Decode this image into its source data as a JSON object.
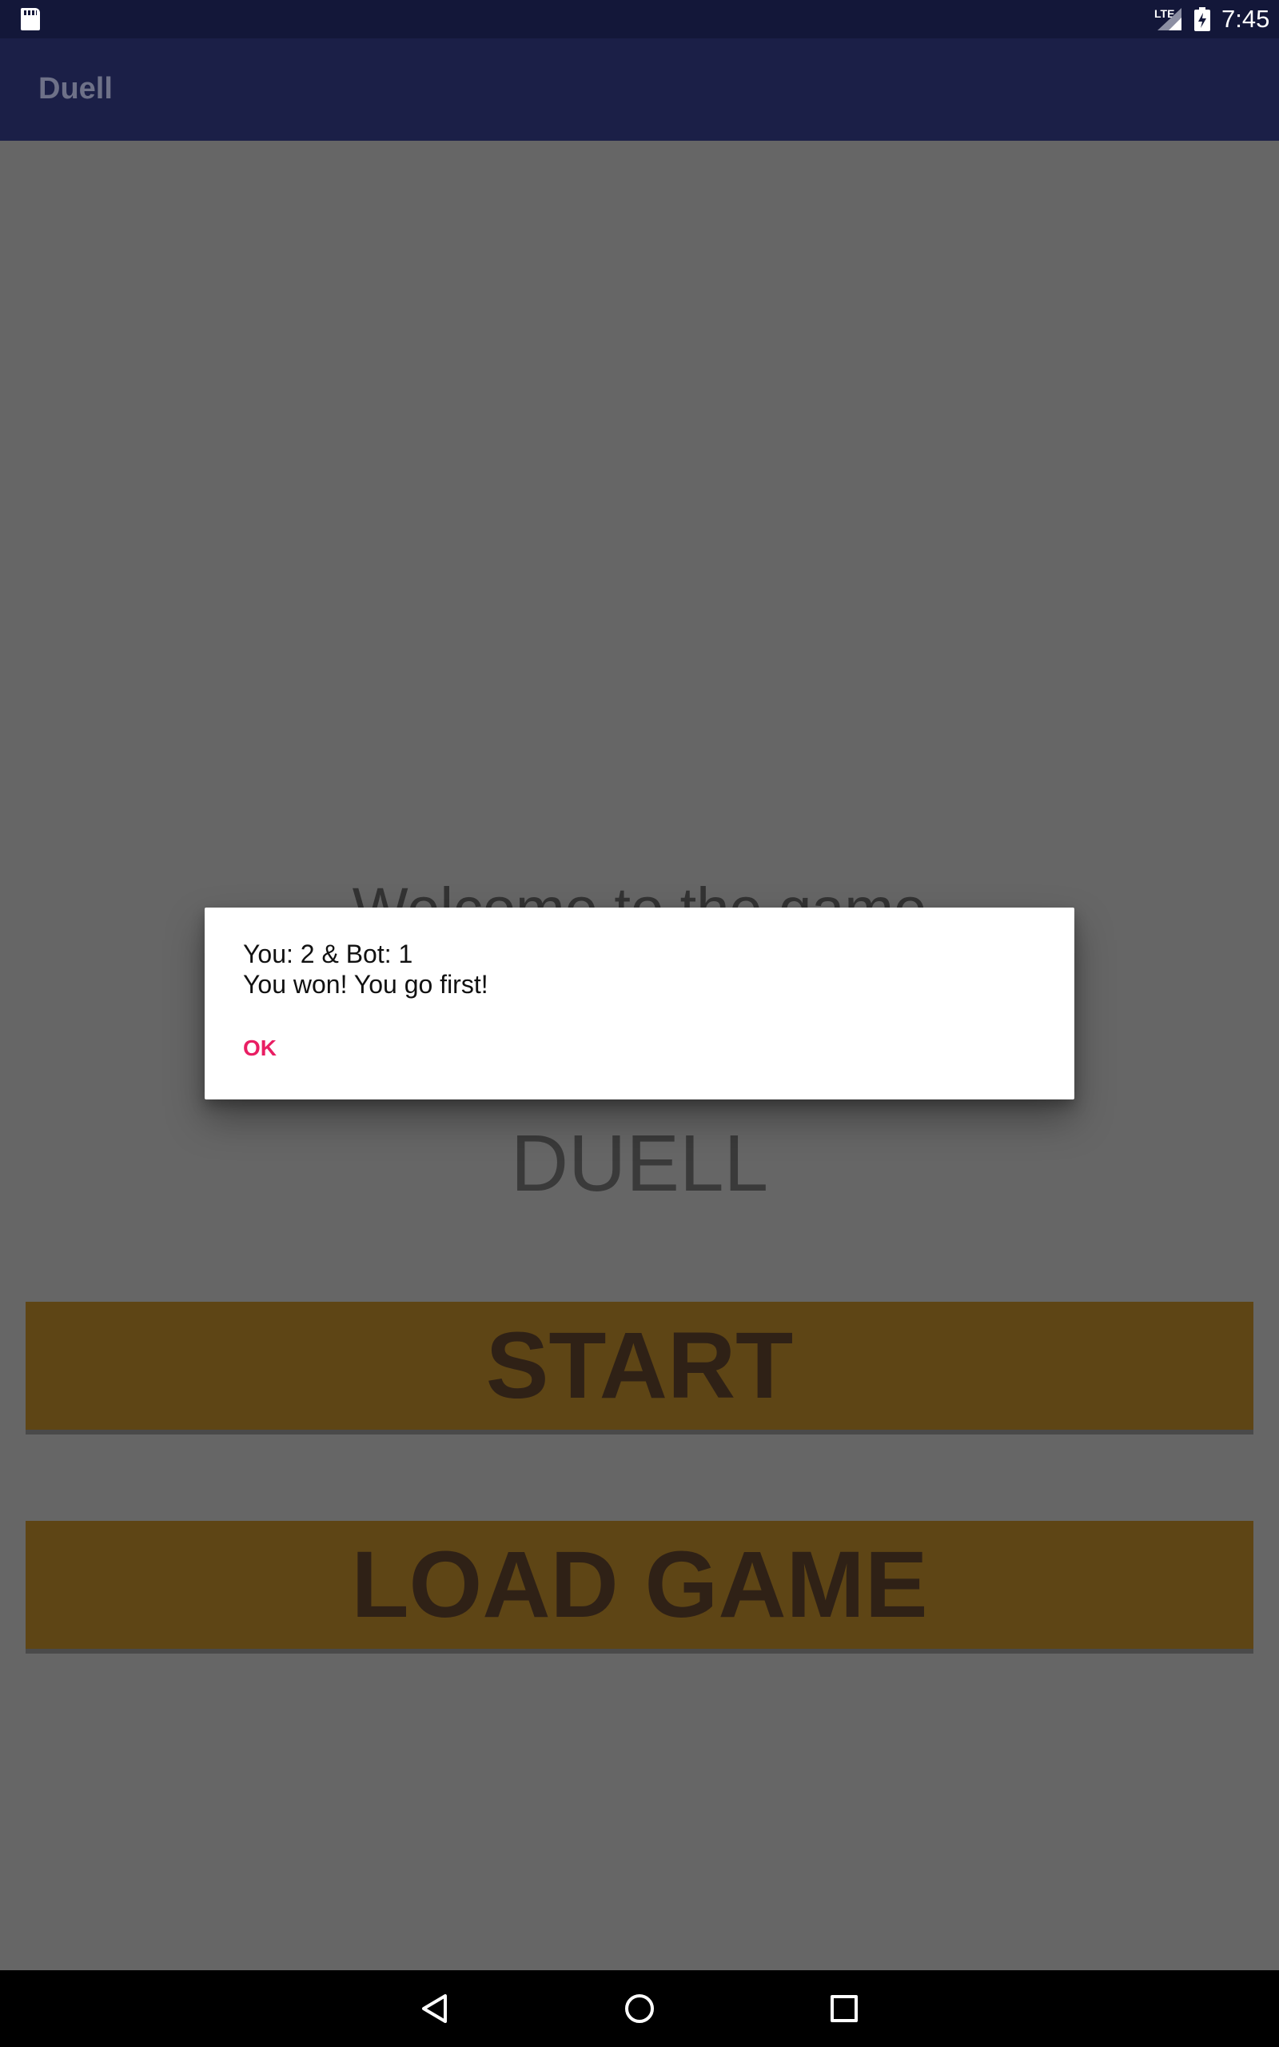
{
  "status_bar": {
    "lte": "LTE",
    "time": "7:45",
    "icons": [
      "sd-card-icon",
      "signal-icon",
      "battery-charging-icon"
    ]
  },
  "app_bar": {
    "title": "Duell"
  },
  "main": {
    "welcome_text": "Welcome to the game",
    "game_title": "DUELL",
    "start_label": "START",
    "load_label": "LOAD GAME"
  },
  "dialog": {
    "line1": "You: 2 & Bot: 1",
    "line2": "You won! You go first!",
    "ok_label": "OK"
  },
  "nav_bar": {
    "icons": [
      "back-icon",
      "home-icon",
      "recents-icon"
    ]
  },
  "colors": {
    "status_bar": "#131739",
    "app_bar": "#1b1f47",
    "scrim_background": "#666666",
    "button": "#5e4515",
    "accent": "#e91e63"
  }
}
